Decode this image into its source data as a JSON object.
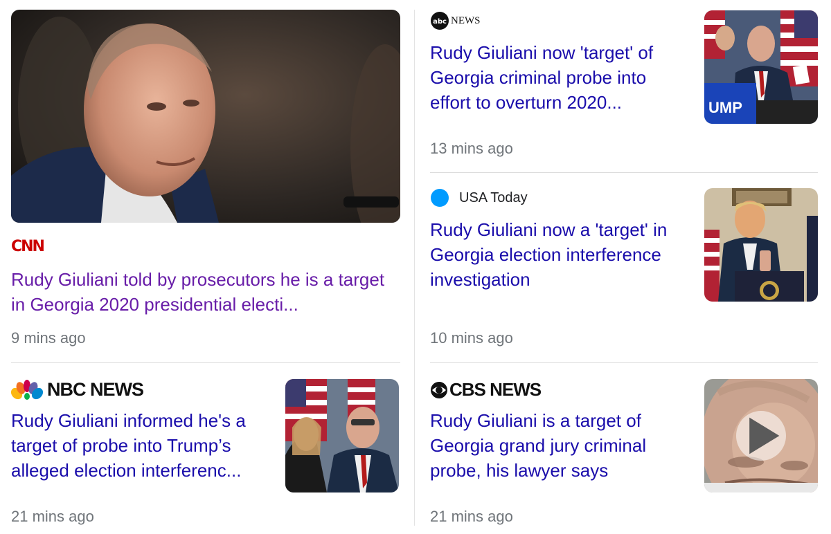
{
  "articles": [
    {
      "source": "CNN",
      "headline": "Rudy Giuliani told by prosecutors he is a target in Georgia 2020 presidential electi...",
      "time": "9 mins ago",
      "visited": true,
      "thumbnail": "rudy-giuliani-portrait"
    },
    {
      "source": "NEWS",
      "source_prefix": "abc",
      "headline": "Rudy Giuliani now 'target' of Georgia criminal probe into effort to overturn 2020...",
      "time": "13 mins ago",
      "thumbnail": "giuliani-press-conference"
    },
    {
      "source": "USA Today",
      "headline": "Rudy Giuliani now a 'target' in Georgia election interference investigation",
      "time": "10 mins ago",
      "thumbnail": "trump-podium"
    },
    {
      "source": "NBC NEWS",
      "headline": "Rudy Giuliani informed he's a target of probe into Trump’s alleged election interferenc...",
      "time": "21 mins ago",
      "thumbnail": "giuliani-flags"
    },
    {
      "source": "CBS NEWS",
      "headline": "Rudy Giuliani is a target of Georgia grand jury criminal probe, his lawyer says",
      "time": "21 mins ago",
      "thumbnail": "giuliani-closeup-video",
      "has_video": true
    }
  ],
  "colors": {
    "link": "#1a0dab",
    "visited": "#681da8",
    "meta": "#70757a",
    "cnn_red": "#cc0000"
  }
}
